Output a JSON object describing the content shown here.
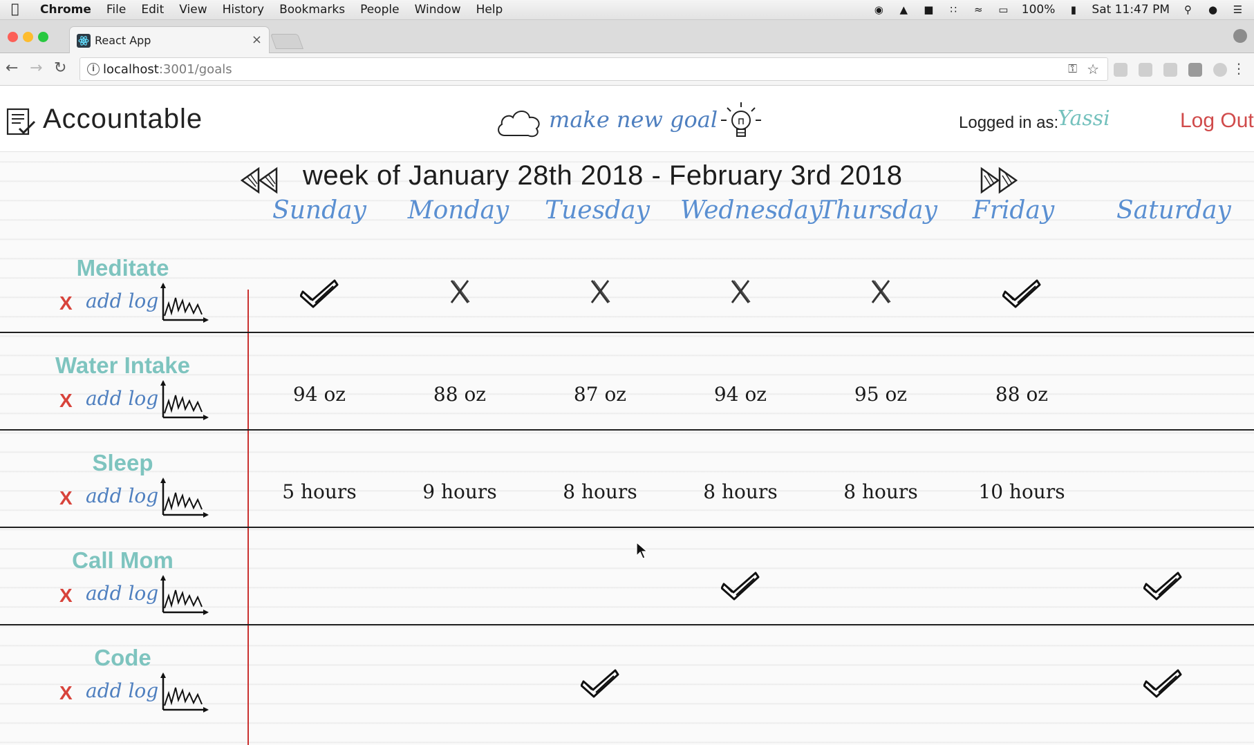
{
  "menubar": {
    "app": "Chrome",
    "items": [
      "File",
      "Edit",
      "View",
      "History",
      "Bookmarks",
      "People",
      "Window",
      "Help"
    ],
    "battery": "100%",
    "clock": "Sat 11:47 PM"
  },
  "browser": {
    "tab_title": "React App",
    "url_host": "localhost",
    "url_rest": ":3001/goals"
  },
  "header": {
    "brand": "Accountable",
    "new_goal": "make new goal",
    "logged_in_label": "Logged in as:",
    "username": "Yassi",
    "logout": "Log Out"
  },
  "week": {
    "title": "week of January 28th 2018 - February 3rd 2018",
    "days": [
      "Sunday",
      "Monday",
      "Tuesday",
      "Wednesday",
      "Thursday",
      "Friday",
      "Saturday"
    ]
  },
  "goals": [
    {
      "name": "Meditate",
      "delete": "X",
      "add_log": "add log",
      "entries": [
        "check",
        "x",
        "x",
        "x",
        "x",
        "check",
        ""
      ]
    },
    {
      "name": "Water Intake",
      "delete": "X",
      "add_log": "add log",
      "entries": [
        "94 oz",
        "88 oz",
        "87 oz",
        "94 oz",
        "95 oz",
        "88 oz",
        ""
      ]
    },
    {
      "name": "Sleep",
      "delete": "X",
      "add_log": "add log",
      "entries": [
        "5 hours",
        "9 hours",
        "8 hours",
        "8 hours",
        "8 hours",
        "10 hours",
        ""
      ]
    },
    {
      "name": "Call Mom",
      "delete": "X",
      "add_log": "add log",
      "entries": [
        "",
        "",
        "",
        "check",
        "",
        "",
        "check"
      ]
    },
    {
      "name": "Code",
      "delete": "X",
      "add_log": "add log",
      "entries": [
        "",
        "",
        "check",
        "",
        "",
        "",
        "check"
      ]
    }
  ],
  "icons": {
    "brand": "checklist-icon",
    "new_goal_left": "cloud-icon",
    "new_goal_right": "lightbulb-icon",
    "prev": "rewind-icon",
    "next": "fast-forward-icon",
    "goal_chart": "line-chart-icon",
    "done": "checkmark-icon",
    "missed": "x-mark-icon"
  },
  "colors": {
    "goal_name": "#7ec4bf",
    "day_header": "#5a8fd1",
    "link_blue": "#4e7fbf",
    "logout_red": "#d04a4a",
    "margin_red": "#c9312f",
    "delete_red": "#d8433b"
  }
}
